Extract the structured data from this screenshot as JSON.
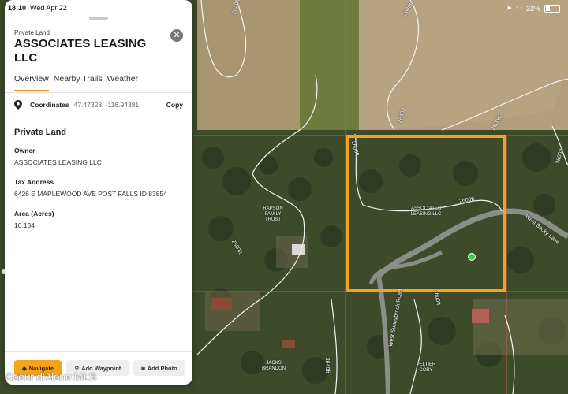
{
  "status": {
    "time": "18:10",
    "date": "Wed Apr 22",
    "battery": "32%"
  },
  "panel": {
    "kicker": "Private Land",
    "title": "ASSOCIATES LEASING LLC",
    "tabs": [
      "Overview",
      "Nearby Trails",
      "Weather"
    ],
    "coordinates": {
      "label": "Coordinates",
      "value": "47.47328, -116.94381",
      "copy": "Copy"
    },
    "section_title": "Private Land",
    "fields": [
      {
        "label": "Owner",
        "value": "ASSOCIATES LEASING LLC"
      },
      {
        "label": "Tax Address",
        "value": "6426 E MAPLEWOOD AVE POST FALLS ID 83854"
      },
      {
        "label": "Area (Acres)",
        "value": "10.134"
      }
    ],
    "actions": {
      "navigate": "Navigate",
      "waypoint": "Add Waypoint",
      "photo": "Add Photo"
    }
  },
  "map": {
    "parcel_label": "ASSOCIATES LEASING LLC",
    "labels": [
      {
        "text": "RAPSON FAMILY TRUST"
      },
      {
        "text": "PELTIER CORY"
      },
      {
        "text": "JACKS BRANDON"
      }
    ],
    "contours": [
      "2640ft",
      "2640ft",
      "2640ft",
      "2600ft",
      "2600ft",
      "2600ft",
      "2560ft",
      "2640ft",
      "2680ft",
      "2600ft"
    ],
    "roads": [
      "West Becky Lane",
      "West Sunnybrook Road"
    ],
    "colors": {
      "parcel": "#f5a31b",
      "accent": "#f08a1a",
      "waypoint": "#3fd34a"
    }
  },
  "watermark": "Coeur d'Alene MLS"
}
